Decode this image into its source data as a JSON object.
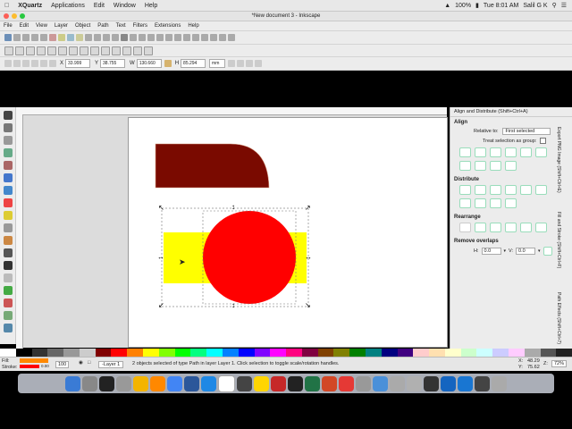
{
  "mac_menu": {
    "app": "XQuartz",
    "items": [
      "Applications",
      "Edit",
      "Window",
      "Help"
    ],
    "battery": "100%",
    "clock": "Tue 8:01 AM",
    "user": "Salil G K"
  },
  "window": {
    "title": "*New document 3 - Inkscape"
  },
  "app_menu": [
    "File",
    "Edit",
    "View",
    "Layer",
    "Object",
    "Path",
    "Text",
    "Filters",
    "Extensions",
    "Help"
  ],
  "coords": {
    "x_label": "X",
    "x_value": "33.999",
    "y_label": "Y",
    "y_value": "38.755",
    "w_label": "W",
    "w_value": "130.660",
    "h_label": "H",
    "h_value": "85.294",
    "unit": "mm"
  },
  "panel": {
    "title": "Align and Distribute (Shift+Ctrl+A)",
    "align_heading": "Align",
    "relative_label": "Relative to:",
    "relative_value": "First selected",
    "treat_label": "Treat selection as group:",
    "distribute_heading": "Distribute",
    "rearrange_heading": "Rearrange",
    "overlaps_heading": "Remove overlaps",
    "h_label": "H:",
    "h_value": "0.0",
    "v_label": "V:",
    "v_value": "0.0",
    "side_tabs": [
      "Export PNG Image (Shift+Ctrl+E)",
      "Fill and Stroke (Shift+Ctrl+F)",
      "Path Effects (Shift+Ctrl+7)"
    ]
  },
  "status": {
    "fill_label": "Fill:",
    "stroke_label": "Stroke:",
    "stroke_width": "0.00",
    "opacity": "100",
    "layer": "-Layer 1",
    "message": "2 objects selected of type Path in layer Layer 1. Click selection to toggle scale/rotation handles.",
    "x_label": "X:",
    "x_value": "48.29",
    "y_label": "Y:",
    "y_value": "75.62",
    "zoom_label": "Z:",
    "zoom_value": "72%"
  },
  "colors": {
    "dark_red": "#7a0a00",
    "yellow": "#ffff00",
    "red": "#ff0000",
    "accent": "#3d7ed8"
  }
}
